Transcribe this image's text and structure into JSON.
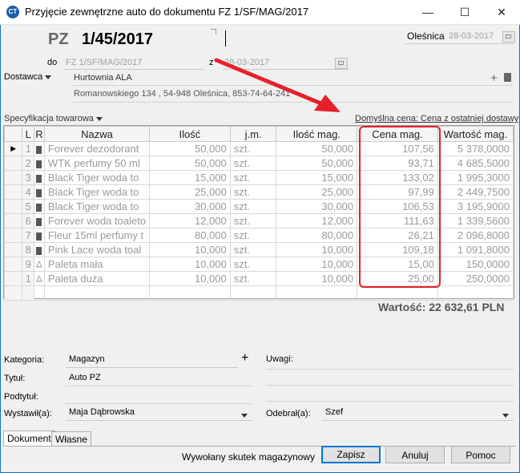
{
  "window": {
    "title": "Przyjęcie zewnętrzne auto do dokumentu FZ 1/SF/MAG/2017",
    "icon": "app-logo-icon",
    "minimize_glyph": "—",
    "maximize_glyph": "☐",
    "close_glyph": "✕"
  },
  "header": {
    "doc_type": "PZ",
    "doc_number": "1/45/2017",
    "place": "Oleśnica",
    "date": "28-03-2017",
    "do_label": "do",
    "do_value": "FZ 1/SF/MAG/2017",
    "z_label": "z",
    "z_date": "28-03-2017"
  },
  "supplier": {
    "label": "Dostawca",
    "name": "Hurtownia ALA",
    "address": "Romanowskiego 134 , 54-948 Oleśnica, 853-74-64-241",
    "plus": "+"
  },
  "spec": {
    "label": "Specyfikacja towarowa",
    "default_price": "Domyślna cena: Cena z ostatniej dostawy"
  },
  "table": {
    "columns": [
      "",
      "L",
      "R",
      "Nazwa",
      "Ilość",
      "j.m.",
      "Ilość mag.",
      "Cena mag.",
      "Wartość mag."
    ],
    "rows": [
      {
        "lp": "1",
        "name": "Forever dezodorant",
        "qty": "50,000",
        "unit": "szt.",
        "qty_mag": "50,000",
        "price": "107,56",
        "value": "5 378,0000",
        "current": true
      },
      {
        "lp": "2",
        "name": "WTK perfumy 50 ml",
        "qty": "50,000",
        "unit": "szt.",
        "qty_mag": "50,000",
        "price": "93,71",
        "value": "4 685,5000"
      },
      {
        "lp": "3",
        "name": "Black Tiger woda to",
        "qty": "15,000",
        "unit": "szt.",
        "qty_mag": "15,000",
        "price": "133,02",
        "value": "1 995,3000"
      },
      {
        "lp": "4",
        "name": "Black Tiger woda to",
        "qty": "25,000",
        "unit": "szt.",
        "qty_mag": "25,000",
        "price": "97,99",
        "value": "2 449,7500"
      },
      {
        "lp": "5",
        "name": "Black Tiger woda to",
        "qty": "30,000",
        "unit": "szt.",
        "qty_mag": "30,000",
        "price": "106,53",
        "value": "3 195,9000"
      },
      {
        "lp": "6",
        "name": "Forever woda toaleto",
        "qty": "12,000",
        "unit": "szt.",
        "qty_mag": "12,000",
        "price": "111,63",
        "value": "1 339,5600"
      },
      {
        "lp": "7",
        "name": "Fleur 15ml perfumy t",
        "qty": "80,000",
        "unit": "szt.",
        "qty_mag": "80,000",
        "price": "26,21",
        "value": "2 096,8000"
      },
      {
        "lp": "8",
        "name": "Pink Lace woda toal",
        "qty": "10,000",
        "unit": "szt.",
        "qty_mag": "10,000",
        "price": "109,18",
        "value": "1 091,8000"
      },
      {
        "lp": "9",
        "name": "Paleta mała",
        "qty": "10,000",
        "unit": "szt.",
        "qty_mag": "10,000",
        "price": "15,00",
        "value": "150,0000",
        "pallet": true
      },
      {
        "lp": "1",
        "name": "Paleta duża",
        "qty": "10,000",
        "unit": "szt.",
        "qty_mag": "10,000",
        "price": "25,00",
        "value": "250,0000",
        "pallet": true
      }
    ],
    "total": "Wartość: 22 632,61 PLN"
  },
  "form": {
    "kategoria_label": "Kategoria:",
    "kategoria_value": "Magazyn",
    "tytul_label": "Tytuł:",
    "tytul_value": "Auto PZ",
    "podtytul_label": "Podtytuł:",
    "podtytul_value": "",
    "wystawil_label": "Wystawił(a):",
    "wystawil_value": "Maja Dąbrowska",
    "uwagi_label": "Uwagi:",
    "odebral_label": "Odebrał(a):",
    "odebral_value": "Szef",
    "plus": "+"
  },
  "tabs": [
    "Dokument",
    "Własne"
  ],
  "footer": {
    "status": "Wywołany skutek magazynowy",
    "save": "Zapisz",
    "cancel": "Anuluj",
    "help": "Pomoc"
  },
  "colors": {
    "highlight": "#e5202a",
    "title_accent": "#1a6fbf"
  }
}
